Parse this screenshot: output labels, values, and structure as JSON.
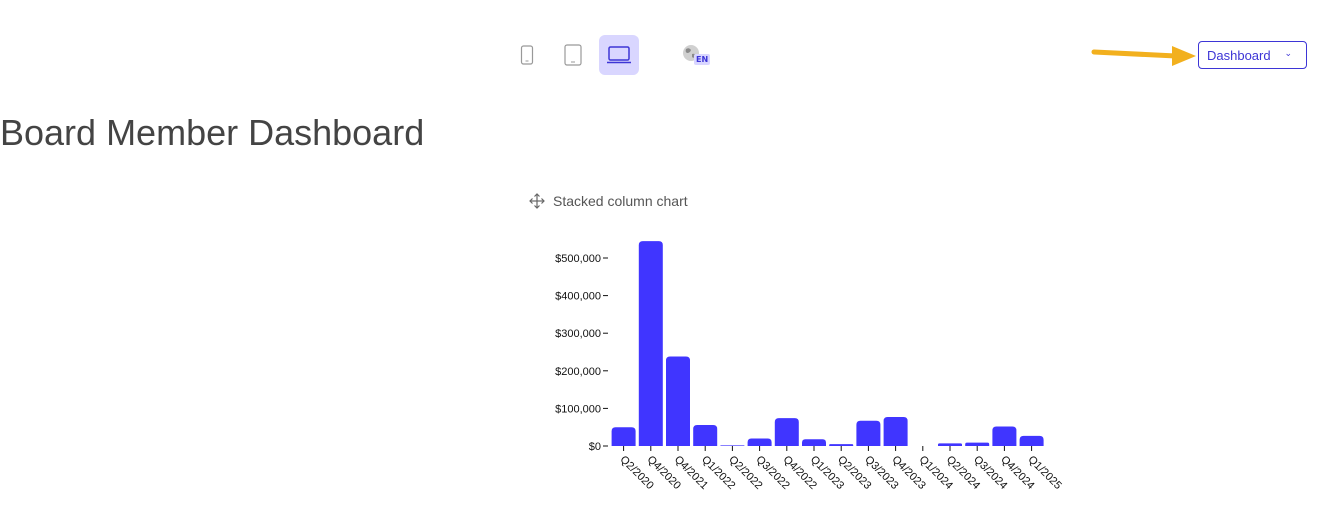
{
  "toolbar": {
    "devices": [
      {
        "icon": "phone-icon",
        "active": false
      },
      {
        "icon": "tablet-icon",
        "active": false
      },
      {
        "icon": "laptop-icon",
        "active": true
      }
    ],
    "language_code": "EN",
    "dashboard_select": {
      "value": "Dashboard"
    }
  },
  "page": {
    "title": "Board Member Dashboard"
  },
  "colors": {
    "accent": "#3d35d6",
    "bar": "#4035ff",
    "device_active_bg": "#d9d6ff",
    "arrow": "#f2b01e"
  },
  "chart_card": {
    "title": "Stacked column chart"
  },
  "chart_data": {
    "type": "bar",
    "stacked": true,
    "categories": [
      "Q2/2020",
      "Q4/2020",
      "Q4/2021",
      "Q1/2022",
      "Q2/2022",
      "Q3/2022",
      "Q4/2022",
      "Q1/2023",
      "Q2/2023",
      "Q3/2023",
      "Q4/2023",
      "Q1/2024",
      "Q2/2024",
      "Q3/2024",
      "Q4/2024",
      "Q1/2025"
    ],
    "series": [
      {
        "values": [
          50000,
          545000,
          238000,
          56000,
          1500,
          20000,
          74000,
          18000,
          5000,
          67000,
          77000,
          0,
          7000,
          9000,
          52000,
          27000
        ]
      }
    ],
    "ylim": [
      0,
      500000
    ],
    "yticks": [
      0,
      100000,
      200000,
      300000,
      400000,
      500000
    ],
    "ytick_labels": [
      "$0",
      "$100,000",
      "$200,000",
      "$300,000",
      "$400,000",
      "$500,000"
    ],
    "grid": false
  }
}
